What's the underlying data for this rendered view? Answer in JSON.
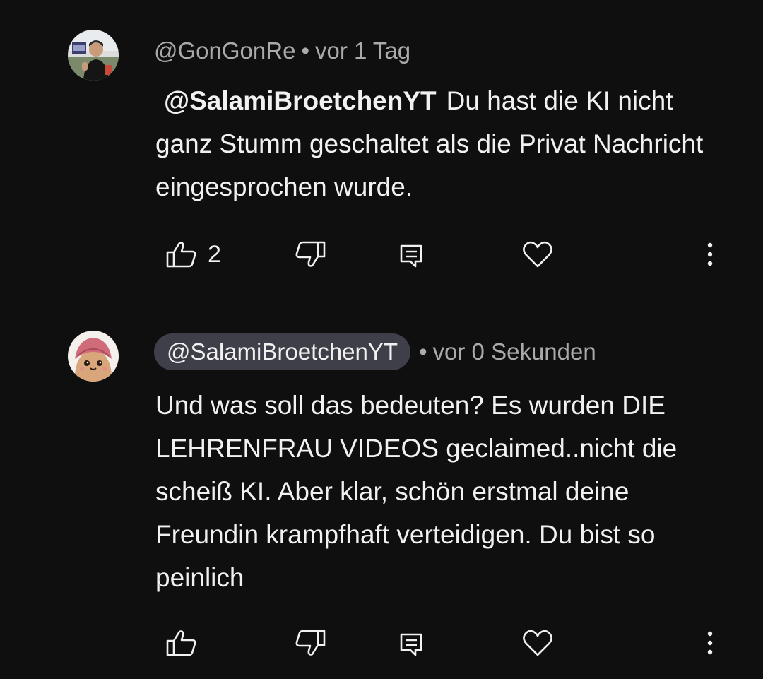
{
  "comments": [
    {
      "author": "@GonGonRe",
      "separator": "•",
      "time": "vor 1 Tag",
      "mention": "@SalamiBroetchenYT",
      "text": "Du hast die KI nicht ganz Stumm geschaltet als die Privat Nachricht eingesprochen wurde.",
      "likes": "2",
      "icons": [
        "like-icon",
        "dislike-icon",
        "reply-icon",
        "heart-icon",
        "more-vert-icon"
      ]
    },
    {
      "author": "@SalamiBroetchenYT",
      "separator": "•",
      "time": "vor 0 Sekunden",
      "text": "Und was soll das bedeuten? Es wurden DIE LEHRENFRAU VIDEOS geclaimed..nicht die scheiß KI. Aber klar, schön erstmal deine Freundin krampfhaft verteidigen. Du bist so peinlich",
      "likes": "",
      "icons": [
        "like-icon",
        "dislike-icon",
        "reply-icon",
        "heart-icon",
        "more-vert-icon"
      ]
    }
  ],
  "colors": {
    "background": "#0f0f0f",
    "text_primary": "#f1f1f1",
    "text_secondary": "#aaaaaa",
    "owner_pill": "#3f3f4a"
  }
}
